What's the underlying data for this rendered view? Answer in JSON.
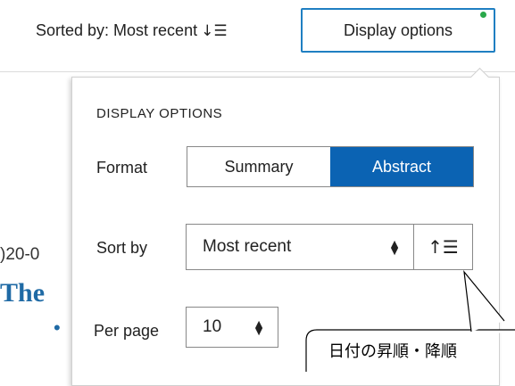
{
  "toolbar": {
    "sort_status": "Sorted by: Most recent",
    "sort_glyph": "↓☰",
    "display_options_label": "Display options",
    "notify_color": "#2aa84a"
  },
  "background": {
    "date_fragment": ")20-0",
    "title_fragment": "The",
    "bullet": "•"
  },
  "panel": {
    "heading": "DISPLAY OPTIONS",
    "format_label": "Format",
    "format_options": [
      "Summary",
      "Abstract"
    ],
    "format_selected": "Abstract",
    "sort_label": "Sort by",
    "sort_value": "Most recent",
    "sort_order_glyph": "↑☰",
    "per_page_label": "Per page",
    "per_page_value": "10",
    "accent_color": "#0b63b3"
  },
  "callout": {
    "text": "日付の昇順・降順"
  }
}
